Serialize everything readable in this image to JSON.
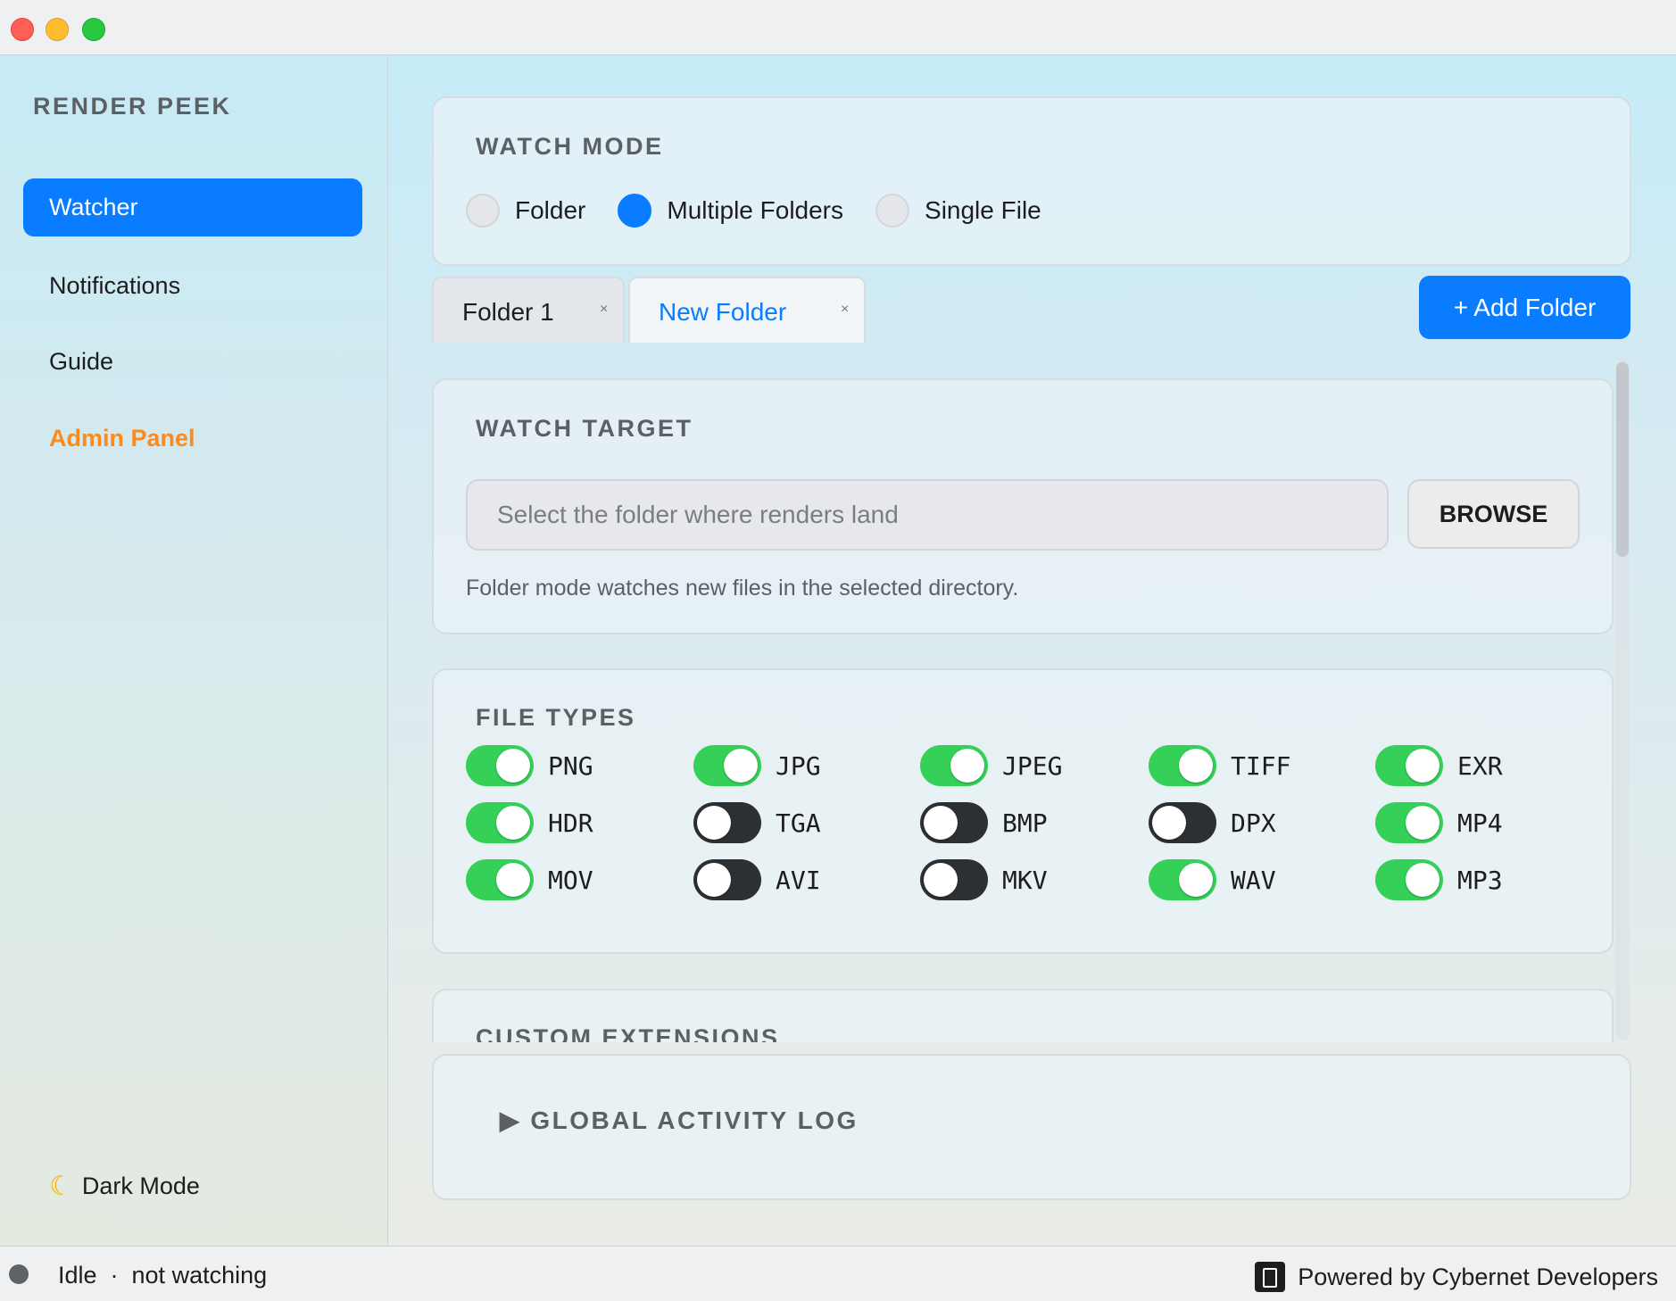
{
  "window": {
    "controls": [
      "close",
      "minimize",
      "zoom"
    ]
  },
  "sidebar": {
    "app_title": "RENDER PEEK",
    "items": [
      {
        "label": "Watcher",
        "active": true
      },
      {
        "label": "Notifications"
      },
      {
        "label": "Guide"
      },
      {
        "label": "Admin Panel",
        "accent": "#ff8a1c"
      }
    ],
    "dark_mode": {
      "icon": "moon-icon",
      "label": "Dark Mode"
    }
  },
  "watch_mode": {
    "title": "WATCH MODE",
    "options": [
      {
        "label": "Folder",
        "selected": false
      },
      {
        "label": "Multiple Folders",
        "selected": true
      },
      {
        "label": "Single File",
        "selected": false
      }
    ]
  },
  "tabs": [
    {
      "label": "Folder 1",
      "close": "×",
      "active": false
    },
    {
      "label": "New Folder",
      "close": "×",
      "active": true
    }
  ],
  "add_folder_label": "+ Add Folder",
  "watch_target": {
    "title": "WATCH TARGET",
    "placeholder": "Select the folder where renders land",
    "browse_label": "BROWSE",
    "hint": "Folder mode watches new files in the selected directory."
  },
  "file_types": {
    "title": "FILE TYPES",
    "items": [
      {
        "label": "PNG",
        "on": true
      },
      {
        "label": "JPG",
        "on": true
      },
      {
        "label": "JPEG",
        "on": true
      },
      {
        "label": "TIFF",
        "on": true
      },
      {
        "label": "EXR",
        "on": true
      },
      {
        "label": "HDR",
        "on": true
      },
      {
        "label": "TGA",
        "on": false
      },
      {
        "label": "BMP",
        "on": false
      },
      {
        "label": "DPX",
        "on": false
      },
      {
        "label": "MP4",
        "on": true
      },
      {
        "label": "MOV",
        "on": true
      },
      {
        "label": "AVI",
        "on": false
      },
      {
        "label": "MKV",
        "on": false
      },
      {
        "label": "WAV",
        "on": true
      },
      {
        "label": "MP3",
        "on": true
      }
    ]
  },
  "custom_extensions": {
    "title": "CUSTOM EXTENSIONS"
  },
  "activity_log": {
    "title": "▶ GLOBAL ACTIVITY LOG"
  },
  "status": {
    "text": "Idle  ·  not watching",
    "powered_by": "Powered by Cybernet Developers"
  },
  "colors": {
    "accent": "#0a7cff",
    "toggle_on": "#34d058",
    "toggle_off": "#2c2f33",
    "admin": "#ff8a1c"
  }
}
